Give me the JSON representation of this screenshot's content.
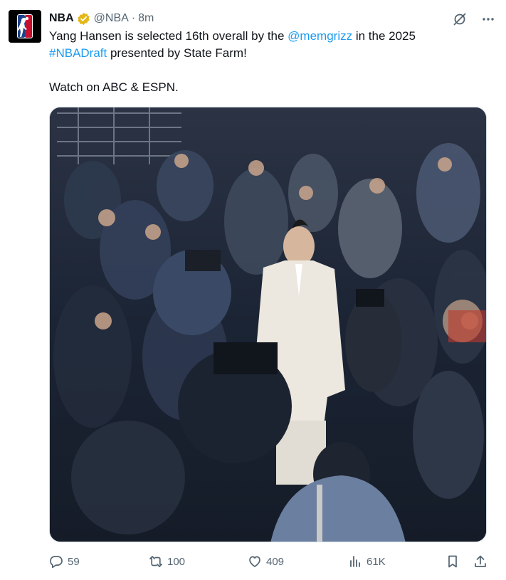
{
  "tweet": {
    "author_name": "NBA",
    "handle": "@NBA",
    "separator": "·",
    "time": "8m",
    "text": {
      "line1_pre": "Yang Hansen is selected 16th overall by the ",
      "line1_mention": "@memgrizz",
      "line1_post": " in the 2025",
      "line2_hashtag": "#NBADraft",
      "line2_post": " presented by State Farm!",
      "line3": "Watch on ABC & ESPN."
    },
    "media": {
      "alt": ""
    },
    "counts": {
      "replies": "59",
      "reposts": "100",
      "likes": "409",
      "views": "61K"
    }
  },
  "colors": {
    "link": "#1d9bf0",
    "verified": "#e2b719",
    "muted": "#536471"
  },
  "icons": [
    "grok-icon",
    "more-icon",
    "reply-icon",
    "repost-icon",
    "like-icon",
    "views-icon",
    "bookmark-icon",
    "share-icon"
  ]
}
